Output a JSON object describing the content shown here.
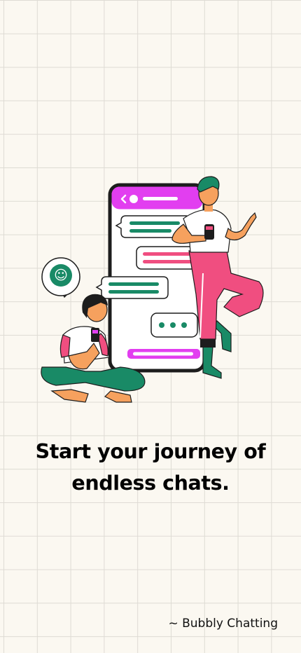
{
  "onboarding": {
    "headline": "Start your journey of endless chats.",
    "signature": "~ Bubbly Chatting"
  },
  "illustration": {
    "emoji_symbol": "☺"
  },
  "colors": {
    "background": "#fbf8f1",
    "grid_line": "#dedbd4",
    "accent_purple": "#e23ef0",
    "accent_pink": "#f04e80",
    "accent_green": "#198a66",
    "text": "#000000"
  }
}
